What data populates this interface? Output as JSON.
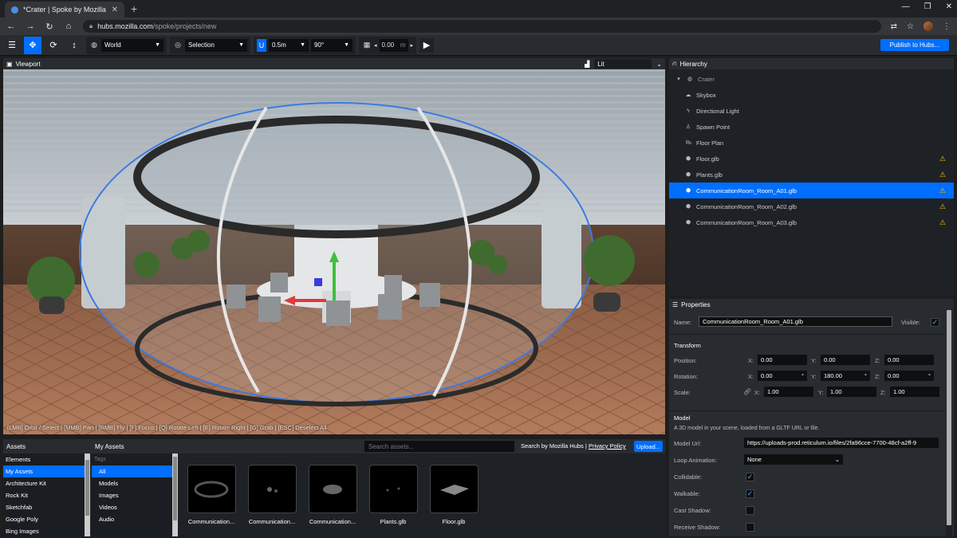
{
  "browser": {
    "tab_title": "*Crater | Spoke by Mozilla",
    "new_tab": "+",
    "url_host": "hubs.mozilla.com",
    "url_path": "/spoke/projects/new"
  },
  "toolbar": {
    "space": "World",
    "pivot": "Selection",
    "snap_translate": "0.5m",
    "snap_rotate": "90°",
    "grid_height": "0.00",
    "grid_unit": "m",
    "publish": "Publish to Hubs..."
  },
  "viewport": {
    "title": "Viewport",
    "render_mode": "Lit",
    "hint": "[LMB] Orbit / Select | [MMB] Pan | [RMB] Fly | [F] Focus | [Q] Rotate Left | [E] Rotate Right | [G] Grab | [ESC] Deselect All"
  },
  "hierarchy": {
    "title": "Hierarchy",
    "root": "Crater",
    "items": [
      {
        "label": "Skybox",
        "icon": "cloud-icon",
        "warn": false
      },
      {
        "label": "Directional Light",
        "icon": "bolt-icon",
        "warn": false
      },
      {
        "label": "Spawn Point",
        "icon": "person-icon",
        "warn": false
      },
      {
        "label": "Floor Plan",
        "icon": "shoe-icon",
        "warn": false
      },
      {
        "label": "Floor.glb",
        "icon": "cube-icon",
        "warn": true
      },
      {
        "label": "Plants.glb",
        "icon": "cube-icon",
        "warn": true
      },
      {
        "label": "CommunicationRoom_Room_A01.glb",
        "icon": "cube-icon",
        "warn": true,
        "selected": true
      },
      {
        "label": "CommunicationRoom_Room_A02.glb",
        "icon": "cube-icon",
        "warn": true
      },
      {
        "label": "CommunicationRoom_Room_A03.glb",
        "icon": "cube-icon",
        "warn": true
      }
    ]
  },
  "properties": {
    "title": "Properties",
    "name_label": "Name:",
    "name_value": "CommunicationRoom_Room_A01.glb",
    "visible_label": "Visible:",
    "transform_title": "Transform",
    "position_label": "Position:",
    "rotation_label": "Rotation:",
    "scale_label": "Scale:",
    "axis_x": "X:",
    "axis_y": "Y:",
    "axis_z": "Z:",
    "degree": "°",
    "position": {
      "x": "0.00",
      "y": "0.00",
      "z": "0.00"
    },
    "rotation": {
      "x": "0.00",
      "y": "180.00",
      "z": "0.00"
    },
    "scale": {
      "x": "1.00",
      "y": "1.00",
      "z": "1.00"
    },
    "model_title": "Model",
    "model_desc": "A 3D model in your scene, loaded from a GLTF URL or file.",
    "model_url_label": "Model Url:",
    "model_url": "https://uploads-prod.reticulum.io/files/2fa96cce-7700-48cf-a2ff-9",
    "loop_label": "Loop Animation:",
    "loop_value": "None",
    "collidable_label": "Collidable:",
    "walkable_label": "Walkable:",
    "cast_shadow_label": "Cast Shadow:",
    "receive_shadow_label": "Receive Shadow:"
  },
  "assets": {
    "title": "Assets",
    "current": "My Assets",
    "search_placeholder": "Search assets...",
    "search_by": "Search by Mozilla Hubs",
    "sep": "|",
    "privacy": "Privacy Policy",
    "upload": "Upload...",
    "sources": [
      "Elements",
      "My Assets",
      "Architecture Kit",
      "Rock Kit",
      "Sketchfab",
      "Google Poly",
      "Bing Images"
    ],
    "tags_header": "Tags",
    "tags": [
      "All",
      "Models",
      "Images",
      "Videos",
      "Audio"
    ],
    "items": [
      "Communication...",
      "Communication...",
      "Communication...",
      "Plants.glb",
      "Floor.glb"
    ]
  }
}
